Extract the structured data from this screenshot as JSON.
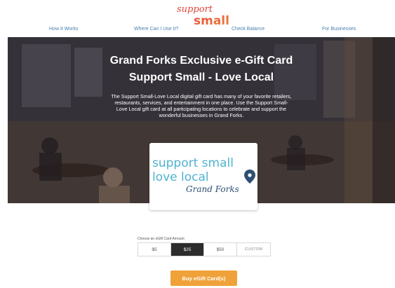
{
  "logo": {
    "top_text": "support",
    "bottom_text": "small"
  },
  "nav": {
    "items": [
      "How It Works",
      "Where Can I Use It?",
      "Check Balance",
      "For Businesses"
    ]
  },
  "hero": {
    "title": "Grand Forks Exclusive e-Gift Card",
    "subtitle": "Support Small - Love Local",
    "description": "The Support Small-Love Local digital gift card has many of your favorite retailers, restaurants, services, and entertainment in one place. Use the Support Small-Love Local gift card at all participating locations to celebrate and support the wonderful businesses in Grand Forks."
  },
  "card": {
    "line1": "support small",
    "line2": "love local",
    "script": "Grand Forks",
    "pin_icon": "map-pin-icon"
  },
  "amount": {
    "label": "Choose an eGift Card Amount",
    "options": [
      "$5",
      "$25",
      "$50",
      "CUSTOM"
    ],
    "selected": "$25"
  },
  "buy_label": "Buy eGift Card(s)",
  "colors": {
    "logo_red": "#e0453a",
    "logo_orange": "#f08a3c",
    "nav_blue": "#4a7fb0",
    "card_teal": "#4fb3cf",
    "card_navy": "#2f4e72",
    "button_orange": "#f0a23a",
    "selected_dark": "#2c2c2c"
  }
}
